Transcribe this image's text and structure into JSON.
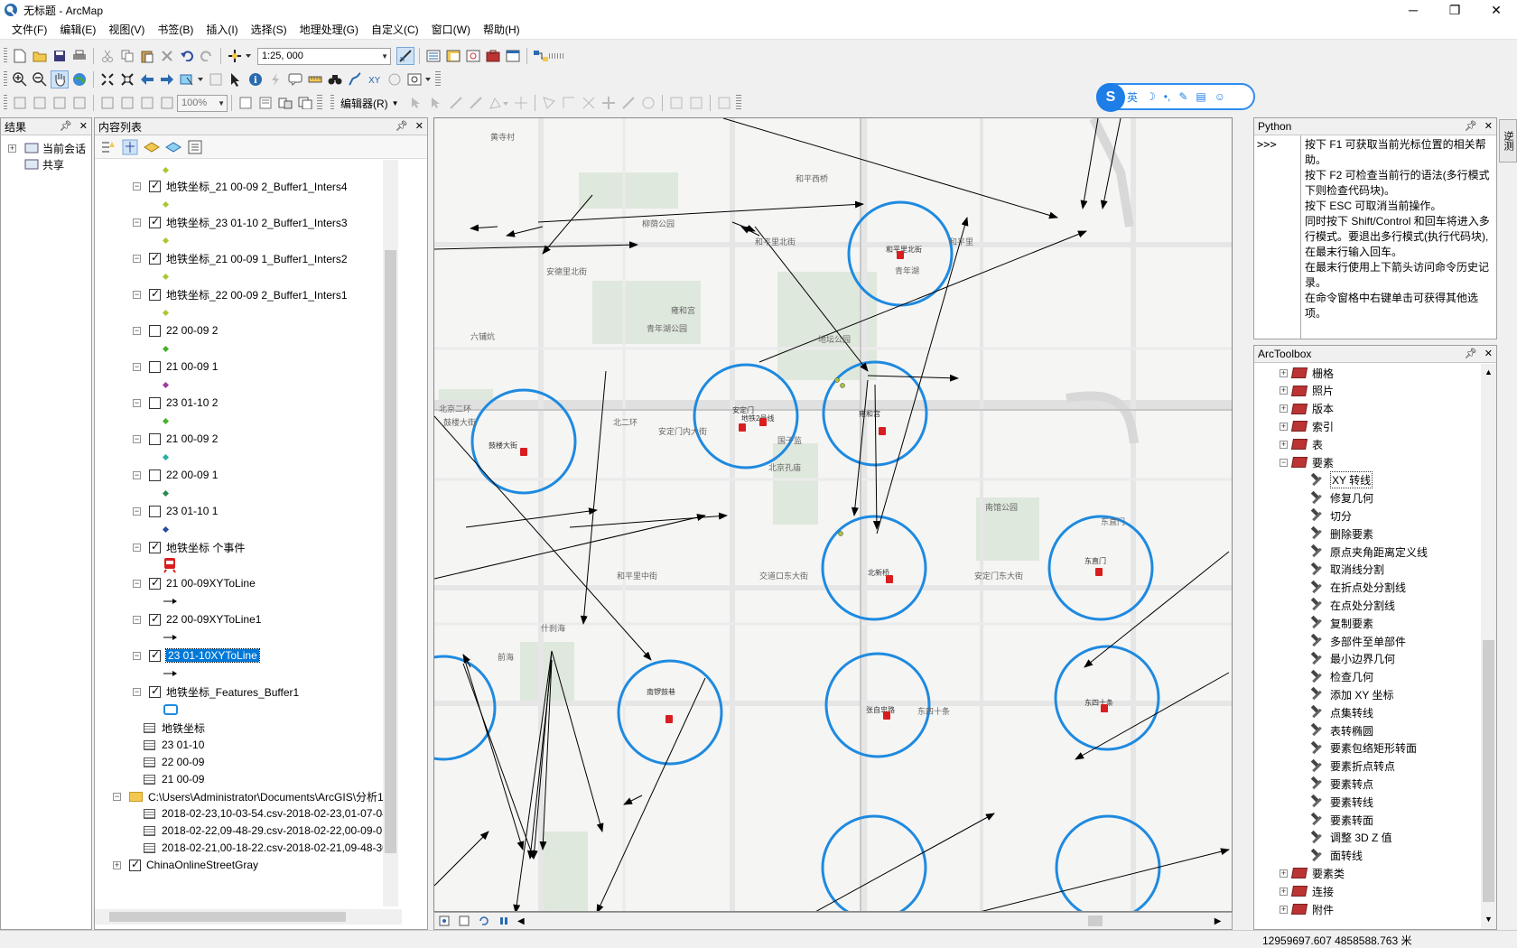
{
  "window": {
    "title": "无标题 - ArcMap"
  },
  "menubar": [
    "文件(F)",
    "编辑(E)",
    "视图(V)",
    "书签(B)",
    "插入(I)",
    "选择(S)",
    "地理处理(G)",
    "自定义(C)",
    "窗口(W)",
    "帮助(H)"
  ],
  "toolbar": {
    "scale_value": "1:25, 000",
    "zoom_percent": "100%",
    "editor_label": "编辑器(R)"
  },
  "ime": {
    "mode": "英"
  },
  "results_panel": {
    "title": "结果",
    "items": [
      "当前会话",
      "共享"
    ]
  },
  "toc": {
    "title": "内容列表",
    "layers": [
      {
        "label": "地铁坐标_21 00-09 2_Buffer1_Inters4",
        "checked": true,
        "symbol_color": "#a8c830"
      },
      {
        "label": "地铁坐标_23 01-10 2_Buffer1_Inters3",
        "checked": true,
        "symbol_color": "#a8c830"
      },
      {
        "label": "地铁坐标_21 00-09 1_Buffer1_Inters2",
        "checked": true,
        "symbol_color": "#a8c830"
      },
      {
        "label": "地铁坐标_22 00-09 2_Buffer1_Inters1",
        "checked": true,
        "symbol_color": "#a8c830"
      },
      {
        "label": "22 00-09 2",
        "checked": false,
        "symbol_color": "#4ab02a"
      },
      {
        "label": "21 00-09 1",
        "checked": false,
        "symbol_color": "#a03aa0"
      },
      {
        "label": "23 01-10 2",
        "checked": false,
        "symbol_color": "#4ab02a"
      },
      {
        "label": "21 00-09 2",
        "checked": false,
        "symbol_color": "#2ab0a0"
      },
      {
        "label": "22 00-09 1",
        "checked": false,
        "symbol_color": "#2a8a50"
      },
      {
        "label": "23 01-10 1",
        "checked": false,
        "symbol_color": "#2a4aa0"
      },
      {
        "label": "地铁坐标 个事件",
        "checked": true,
        "symbol_color": "#d81e1e"
      },
      {
        "label": "21 00-09XYToLine",
        "checked": true,
        "symbol_color": "#000000"
      },
      {
        "label": "22 00-09XYToLine1",
        "checked": true,
        "symbol_color": "#000000"
      },
      {
        "label": "23 01-10XYToLine",
        "checked": true,
        "symbol_color": "#000000",
        "selected": true
      },
      {
        "label": "地铁坐标_Features_Buffer1",
        "checked": true,
        "symbol_color": "#1e8ae0"
      }
    ],
    "tables": [
      "地铁坐标",
      "23 01-10",
      "22 00-09",
      "21 00-09"
    ],
    "folder": "C:\\Users\\Administrator\\Documents\\ArcGIS\\分析1",
    "folder_tables": [
      "2018-02-23,10-03-54.csv-2018-02-23,01-07-04",
      "2018-02-22,09-48-29.csv-2018-02-22,00-09-01",
      "2018-02-21,00-18-22.csv-2018-02-21,09-48-30"
    ],
    "basemap": "ChinaOnlineStreetGray"
  },
  "map": {
    "area_labels": [
      "黄寺村",
      "柳荫公园",
      "安德里北街",
      "青年湖公园",
      "雍和宫",
      "地坛公园",
      "北京二环",
      "国子监",
      "北京孔庙",
      "南馆公园",
      "六铺炕",
      "什刹海",
      "前海",
      "和平里",
      "和平里北街",
      "安定门内大街",
      "交道口东大街",
      "东四十条",
      "东直门",
      "和平西桥",
      "青年湖",
      "和平里中街",
      "鼓楼大街",
      "北二环",
      "安定门东大街",
      "东直门内大街"
    ],
    "station_labels": [
      "和平里北街",
      "安定门",
      "雍和宫",
      "鼓楼大街",
      "北新桥",
      "东直门",
      "南锣鼓巷",
      "张自忠路",
      "东四十条",
      "地铁2号线"
    ],
    "buffer_color": "#1e8ae0"
  },
  "python": {
    "title": "Python",
    "prompt": ">>>",
    "help_lines": [
      "按下 F1 可获取当前光标位置的相关帮助。",
      "按下 F2 可检查当前行的语法(多行模式下则检查代码块)。",
      "按下 ESC 可取消当前操作。",
      "同时按下 Shift/Control 和回车将进入多行模式。要退出多行模式(执行代码块),在最末行输入回车。",
      "在最末行使用上下箭头访问命令历史记录。",
      "在命令窗格中右键单击可获得其他选项。"
    ]
  },
  "arctoolbox": {
    "title": "ArcToolbox",
    "top_toolboxes": [
      "栅格",
      "照片",
      "版本",
      "索引",
      "表",
      "要素"
    ],
    "tools": [
      "XY 转线",
      "修复几何",
      "切分",
      "删除要素",
      "原点夹角距离定义线",
      "取消线分割",
      "在折点处分割线",
      "在点处分割线",
      "复制要素",
      "多部件至单部件",
      "最小边界几何",
      "检查几何",
      "添加 XY 坐标",
      "点集转线",
      "表转椭圆",
      "要素包络矩形转面",
      "要素折点转点",
      "要素转点",
      "要素转线",
      "要素转面",
      "调整 3D Z 值",
      "面转线"
    ],
    "bottom_toolboxes": [
      "要素类",
      "连接",
      "附件"
    ]
  },
  "statusbar": {
    "coordinates": "12959697.607  4858588.763 米"
  },
  "right_tab": "逆测"
}
